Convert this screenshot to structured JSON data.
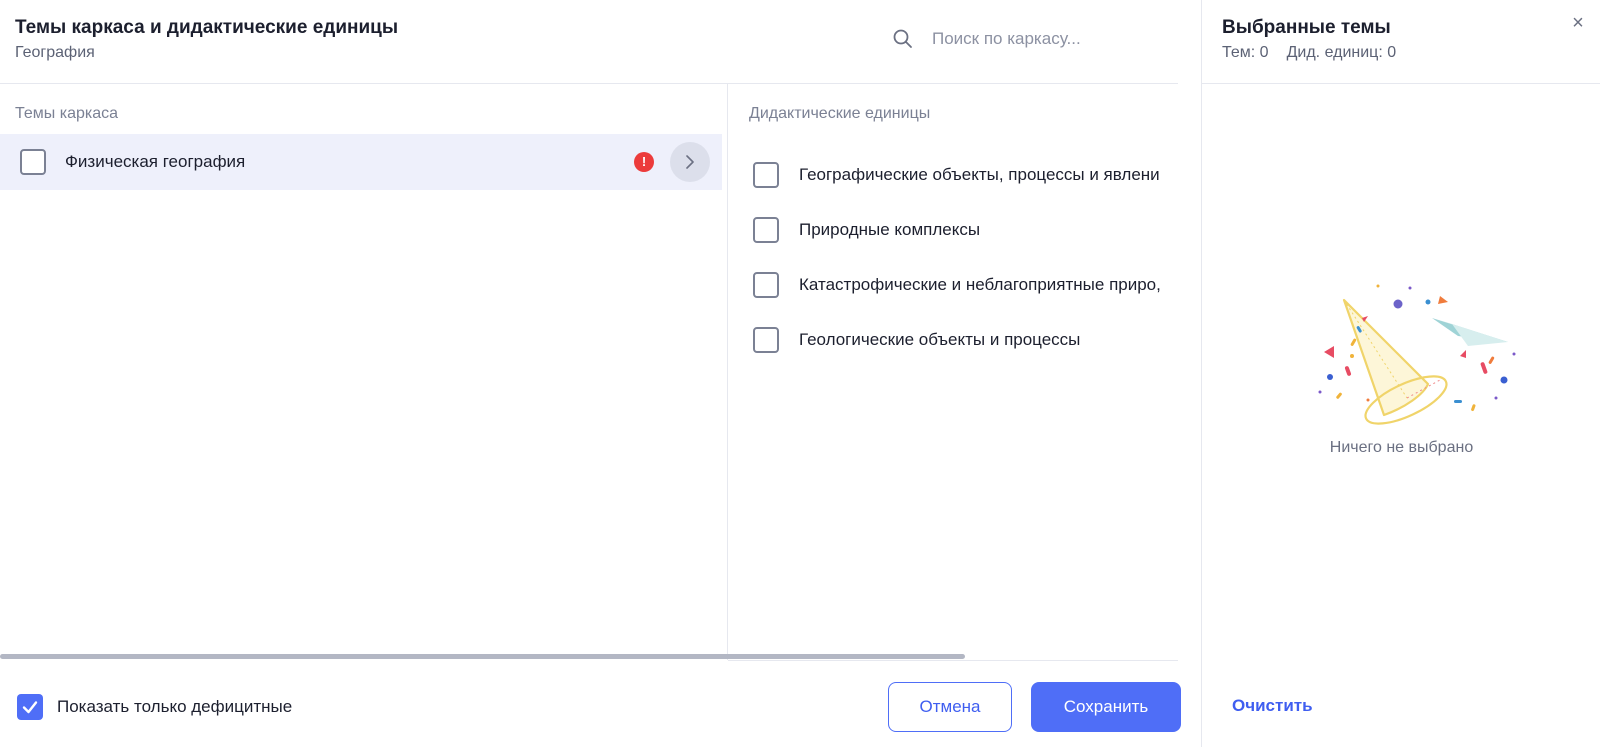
{
  "header": {
    "title": "Темы каркаса и дидактические единицы",
    "subtitle": "География",
    "search_placeholder": "Поиск по каркасу..."
  },
  "left_column": {
    "header": "Темы каркаса",
    "topics": [
      {
        "label": "Физическая география",
        "checked": false,
        "has_warning": true,
        "warning_glyph": "!"
      }
    ]
  },
  "right_column": {
    "header": "Дидактические единицы",
    "units": [
      {
        "label": "Географические объекты, процессы и явлени",
        "checked": false
      },
      {
        "label": "Природные комплексы",
        "checked": false
      },
      {
        "label": "Катастрофические и неблагоприятные приро,",
        "checked": false
      },
      {
        "label": "Геологические объекты и процессы",
        "checked": false
      }
    ]
  },
  "footer": {
    "show_deficit_label": "Показать только дефицитные",
    "show_deficit_checked": true,
    "cancel_label": "Отмена",
    "save_label": "Сохранить"
  },
  "side_panel": {
    "title": "Выбранные темы",
    "topics_count": "Тем: 0",
    "units_count": "Дид. единиц: 0",
    "close_glyph": "×",
    "empty_text": "Ничего не выбрано",
    "clear_label": "Очистить"
  },
  "colors": {
    "accent": "#4f6ef7",
    "warning": "#ec3b3b",
    "row_highlight": "#eef0fb"
  }
}
